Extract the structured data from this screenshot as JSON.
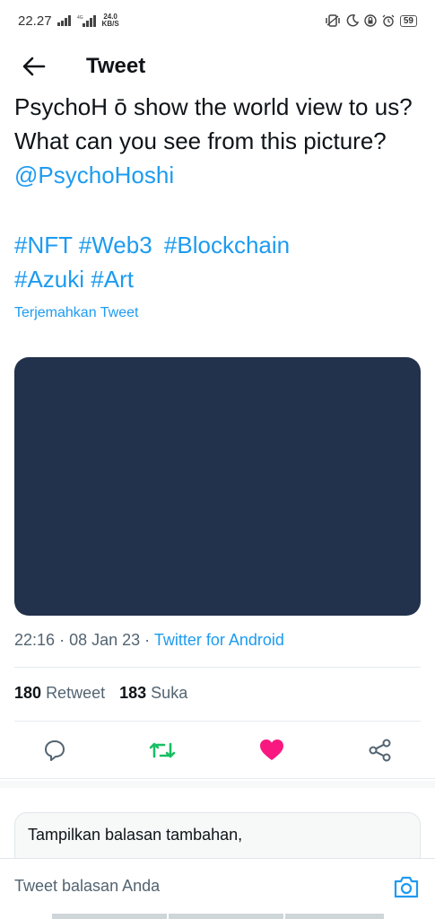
{
  "status_bar": {
    "time": "22.27",
    "net_speed_value": "24.0",
    "net_speed_unit": "KB/S",
    "network_label": "4G",
    "battery": "59"
  },
  "app_bar": {
    "title": "Tweet",
    "back_icon": "arrow-left-icon"
  },
  "tweet": {
    "text_part1": "PsychoH ō show the world view to us? What can you see from this picture? ",
    "mention": "@PsychoHoshi",
    "hashtags": [
      "#NFT",
      "#Web3",
      "#Blockchain",
      "#Azuki",
      "#Art"
    ],
    "translate_label": "Terjemahkan Tweet",
    "time": "22:16",
    "date": "08 Jan 23",
    "source": "Twitter for Android",
    "separator": "·"
  },
  "stats": {
    "retweets_count": "180",
    "retweets_label": "Retweet",
    "likes_count": "183",
    "likes_label": "Suka"
  },
  "actions": {
    "reply_icon": "reply-icon",
    "retweet_icon": "retweet-icon",
    "like_icon": "heart-icon",
    "share_icon": "share-icon",
    "retweet_color": "#17bf63",
    "like_color": "#f91880"
  },
  "more_replies": {
    "label": "Tampilkan balasan tambahan,"
  },
  "reply_bar": {
    "placeholder": "Tweet balasan Anda",
    "camera_icon": "camera-icon"
  },
  "colors": {
    "accent": "#1d9bf0",
    "media_bg": "#22314c"
  }
}
